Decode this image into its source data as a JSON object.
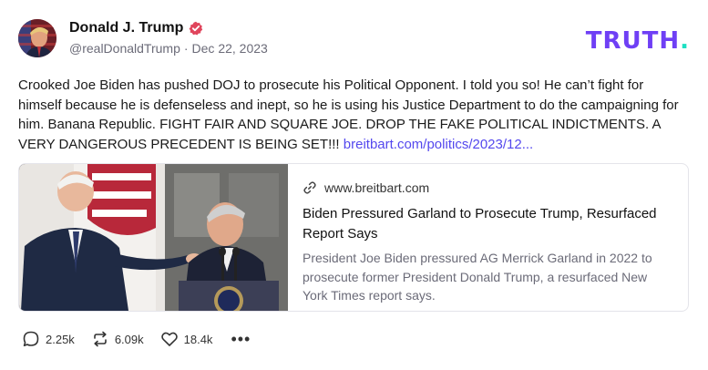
{
  "author": {
    "display_name": "Donald J. Trump",
    "handle": "@realDonaldTrump",
    "date": "Dec 22, 2023",
    "verified": true
  },
  "brand": {
    "name": "TRUTH",
    "dot": "."
  },
  "post": {
    "text": "Crooked Joe Biden has pushed DOJ to prosecute his Political Opponent. I told you so! He can’t fight for himself because he is defenseless and inept, so he is using his Justice Department to do the campaigning for him. Banana Republic. FIGHT FAIR AND SQUARE JOE. DROP THE FAKE POLITICAL INDICTMENTS. A VERY DANGEROUS PRECEDENT IS BEING SET!!!",
    "link": "breitbart.com/politics/2023/12..."
  },
  "link_card": {
    "domain": "www.breitbart.com",
    "title": "Biden Pressured Garland to Prosecute Trump, Resurfaced Report Says",
    "description": "President Joe Biden pressured AG Merrick Garland in 2022 to prosecute former President Donald Trump, a resurfaced New York Times report says."
  },
  "actions": {
    "replies": "2.25k",
    "retruths": "6.09k",
    "likes": "18.4k",
    "more": "•••"
  },
  "colors": {
    "brand_purple": "#6f3ff5",
    "brand_teal": "#1de0c2",
    "link": "#5448ee",
    "verified": "#e0455c"
  }
}
